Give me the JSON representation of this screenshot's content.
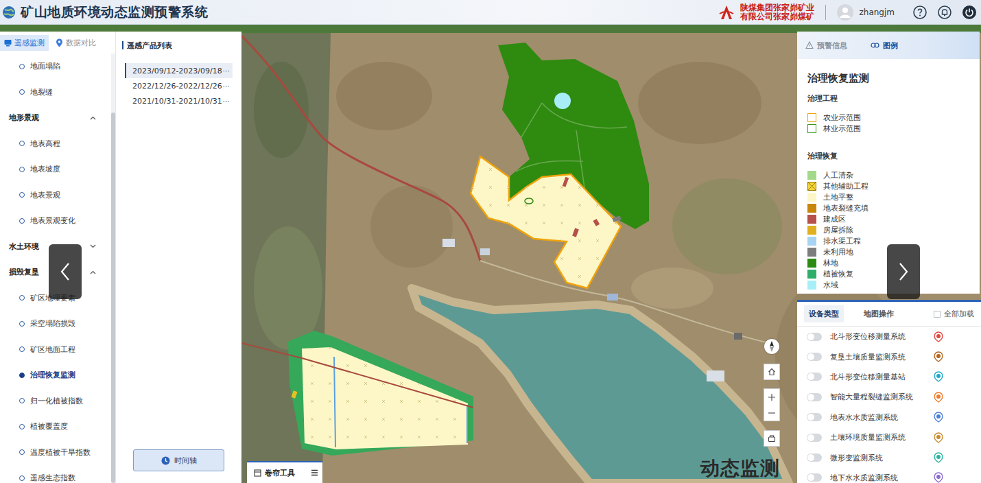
{
  "header": {
    "title": "矿山地质环境动态监测预警系统",
    "company": [
      "陕煤集团张家峁矿业",
      "有限公司张家峁煤矿"
    ],
    "user": "zhangjm"
  },
  "sidebar": {
    "tabs": [
      {
        "label": "遥感监测",
        "selected": true
      },
      {
        "label": "数据对比",
        "selected": false
      }
    ],
    "tree": [
      {
        "kind": "item",
        "label": "地面塌陷",
        "selected": false
      },
      {
        "kind": "item",
        "label": "地裂缝",
        "selected": false
      },
      {
        "kind": "group",
        "label": "地形景观",
        "expanded": true
      },
      {
        "kind": "item",
        "label": "地表高程",
        "selected": false
      },
      {
        "kind": "item",
        "label": "地表坡度",
        "selected": false
      },
      {
        "kind": "item",
        "label": "地表景观",
        "selected": false
      },
      {
        "kind": "item",
        "label": "地表景观变化",
        "selected": false
      },
      {
        "kind": "group",
        "label": "水土环境",
        "expanded": false
      },
      {
        "kind": "group",
        "label": "损毁复垦",
        "expanded": true
      },
      {
        "kind": "item",
        "label": "矿区地理要素",
        "selected": false
      },
      {
        "kind": "item",
        "label": "采空塌陷损毁",
        "selected": false
      },
      {
        "kind": "item",
        "label": "矿区地面工程",
        "selected": false
      },
      {
        "kind": "item",
        "label": "治理恢复监测",
        "selected": true
      },
      {
        "kind": "item",
        "label": "归一化植被指数",
        "selected": false
      },
      {
        "kind": "item",
        "label": "植被覆盖度",
        "selected": false
      },
      {
        "kind": "item",
        "label": "温度植被干旱指数",
        "selected": false
      },
      {
        "kind": "item",
        "label": "遥感生态指数",
        "selected": false
      }
    ]
  },
  "products": {
    "title": "遥感产品列表",
    "items": [
      {
        "date": "2023/09/12-2023/09/18",
        "more": "···",
        "selected": true
      },
      {
        "date": "2022/12/26-2022/12/26",
        "more": "···",
        "selected": false
      },
      {
        "date": "2021/10/31-2021/10/31",
        "more": "···",
        "selected": false
      }
    ],
    "timeline_button": "时间轴"
  },
  "map": {
    "watermark": "动态监测",
    "swipe_tool": "卷帘工具"
  },
  "right_panel": {
    "tabs": [
      {
        "label": "预警信息",
        "selected": false
      },
      {
        "label": "图例",
        "selected": true
      }
    ],
    "legend": {
      "title": "治理恢复监测",
      "sections": [
        {
          "title": "治理工程",
          "items": [
            {
              "label": "农业示范围",
              "kind": "outline",
              "color": "#f0a30a"
            },
            {
              "label": "林业示范围",
              "kind": "outline",
              "color": "#3a9a1a"
            }
          ]
        },
        {
          "title": "治理恢复",
          "items": [
            {
              "label": "人工清杂",
              "kind": "fill",
              "color": "#a3d98a"
            },
            {
              "label": "其他辅助工程",
              "kind": "hatched",
              "color": "#f2d33a"
            },
            {
              "label": "土地平整",
              "kind": "fill",
              "color": "#fdf7c8"
            },
            {
              "label": "地表裂缝充填",
              "kind": "fill",
              "color": "#c8860a"
            },
            {
              "label": "建成区",
              "kind": "fill",
              "color": "#b5504a"
            },
            {
              "label": "房屋拆除",
              "kind": "fill",
              "color": "#e0b020"
            },
            {
              "label": "排水渠工程",
              "kind": "fill",
              "color": "#a6d4f2"
            },
            {
              "label": "未利用地",
              "kind": "fill",
              "color": "#7d7d7d"
            },
            {
              "label": "林地",
              "kind": "fill",
              "color": "#2a8a12"
            },
            {
              "label": "植被恢复",
              "kind": "fill",
              "color": "#2fae6a"
            },
            {
              "label": "水域",
              "kind": "fill",
              "color": "#a6eef8"
            }
          ]
        }
      ]
    }
  },
  "devices": {
    "tabs": [
      {
        "label": "设备类型",
        "selected": true
      },
      {
        "label": "地图操作",
        "selected": false
      }
    ],
    "load_all": {
      "label": "全部加载",
      "checked": false
    },
    "items": [
      {
        "name": "北斗形变位移测量系统",
        "on": false,
        "color": "#e0483e"
      },
      {
        "name": "复垦土壤质量监测系统",
        "on": false,
        "color": "#b5651d"
      },
      {
        "name": "北斗形变位移测量基站",
        "on": false,
        "color": "#1fa8c9"
      },
      {
        "name": "智能大量程裂缝监测系统",
        "on": false,
        "color": "#f07c2b"
      },
      {
        "name": "地表水水质监测系统",
        "on": false,
        "color": "#4a7fd6"
      },
      {
        "name": "土壤环境质量监测系统",
        "on": false,
        "color": "#c98a2e"
      },
      {
        "name": "微形变监测系统",
        "on": false,
        "color": "#2bb3a0"
      },
      {
        "name": "地下水水质监测系统",
        "on": false,
        "color": "#8a6bd1"
      }
    ]
  }
}
